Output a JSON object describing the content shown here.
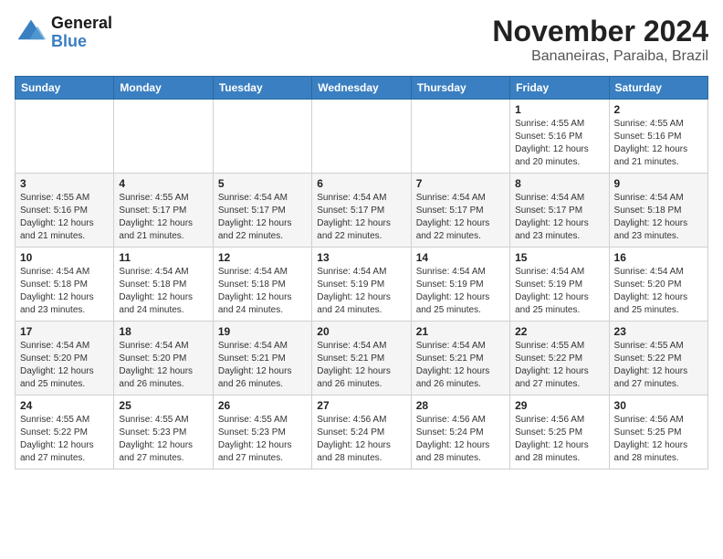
{
  "header": {
    "logo_line1": "General",
    "logo_line2": "Blue",
    "month": "November 2024",
    "location": "Bananeiras, Paraiba, Brazil"
  },
  "weekdays": [
    "Sunday",
    "Monday",
    "Tuesday",
    "Wednesday",
    "Thursday",
    "Friday",
    "Saturday"
  ],
  "weeks": [
    [
      {
        "day": "",
        "info": ""
      },
      {
        "day": "",
        "info": ""
      },
      {
        "day": "",
        "info": ""
      },
      {
        "day": "",
        "info": ""
      },
      {
        "day": "",
        "info": ""
      },
      {
        "day": "1",
        "info": "Sunrise: 4:55 AM\nSunset: 5:16 PM\nDaylight: 12 hours and 20 minutes."
      },
      {
        "day": "2",
        "info": "Sunrise: 4:55 AM\nSunset: 5:16 PM\nDaylight: 12 hours and 21 minutes."
      }
    ],
    [
      {
        "day": "3",
        "info": "Sunrise: 4:55 AM\nSunset: 5:16 PM\nDaylight: 12 hours and 21 minutes."
      },
      {
        "day": "4",
        "info": "Sunrise: 4:55 AM\nSunset: 5:17 PM\nDaylight: 12 hours and 21 minutes."
      },
      {
        "day": "5",
        "info": "Sunrise: 4:54 AM\nSunset: 5:17 PM\nDaylight: 12 hours and 22 minutes."
      },
      {
        "day": "6",
        "info": "Sunrise: 4:54 AM\nSunset: 5:17 PM\nDaylight: 12 hours and 22 minutes."
      },
      {
        "day": "7",
        "info": "Sunrise: 4:54 AM\nSunset: 5:17 PM\nDaylight: 12 hours and 22 minutes."
      },
      {
        "day": "8",
        "info": "Sunrise: 4:54 AM\nSunset: 5:17 PM\nDaylight: 12 hours and 23 minutes."
      },
      {
        "day": "9",
        "info": "Sunrise: 4:54 AM\nSunset: 5:18 PM\nDaylight: 12 hours and 23 minutes."
      }
    ],
    [
      {
        "day": "10",
        "info": "Sunrise: 4:54 AM\nSunset: 5:18 PM\nDaylight: 12 hours and 23 minutes."
      },
      {
        "day": "11",
        "info": "Sunrise: 4:54 AM\nSunset: 5:18 PM\nDaylight: 12 hours and 24 minutes."
      },
      {
        "day": "12",
        "info": "Sunrise: 4:54 AM\nSunset: 5:18 PM\nDaylight: 12 hours and 24 minutes."
      },
      {
        "day": "13",
        "info": "Sunrise: 4:54 AM\nSunset: 5:19 PM\nDaylight: 12 hours and 24 minutes."
      },
      {
        "day": "14",
        "info": "Sunrise: 4:54 AM\nSunset: 5:19 PM\nDaylight: 12 hours and 25 minutes."
      },
      {
        "day": "15",
        "info": "Sunrise: 4:54 AM\nSunset: 5:19 PM\nDaylight: 12 hours and 25 minutes."
      },
      {
        "day": "16",
        "info": "Sunrise: 4:54 AM\nSunset: 5:20 PM\nDaylight: 12 hours and 25 minutes."
      }
    ],
    [
      {
        "day": "17",
        "info": "Sunrise: 4:54 AM\nSunset: 5:20 PM\nDaylight: 12 hours and 25 minutes."
      },
      {
        "day": "18",
        "info": "Sunrise: 4:54 AM\nSunset: 5:20 PM\nDaylight: 12 hours and 26 minutes."
      },
      {
        "day": "19",
        "info": "Sunrise: 4:54 AM\nSunset: 5:21 PM\nDaylight: 12 hours and 26 minutes."
      },
      {
        "day": "20",
        "info": "Sunrise: 4:54 AM\nSunset: 5:21 PM\nDaylight: 12 hours and 26 minutes."
      },
      {
        "day": "21",
        "info": "Sunrise: 4:54 AM\nSunset: 5:21 PM\nDaylight: 12 hours and 26 minutes."
      },
      {
        "day": "22",
        "info": "Sunrise: 4:55 AM\nSunset: 5:22 PM\nDaylight: 12 hours and 27 minutes."
      },
      {
        "day": "23",
        "info": "Sunrise: 4:55 AM\nSunset: 5:22 PM\nDaylight: 12 hours and 27 minutes."
      }
    ],
    [
      {
        "day": "24",
        "info": "Sunrise: 4:55 AM\nSunset: 5:22 PM\nDaylight: 12 hours and 27 minutes."
      },
      {
        "day": "25",
        "info": "Sunrise: 4:55 AM\nSunset: 5:23 PM\nDaylight: 12 hours and 27 minutes."
      },
      {
        "day": "26",
        "info": "Sunrise: 4:55 AM\nSunset: 5:23 PM\nDaylight: 12 hours and 27 minutes."
      },
      {
        "day": "27",
        "info": "Sunrise: 4:56 AM\nSunset: 5:24 PM\nDaylight: 12 hours and 28 minutes."
      },
      {
        "day": "28",
        "info": "Sunrise: 4:56 AM\nSunset: 5:24 PM\nDaylight: 12 hours and 28 minutes."
      },
      {
        "day": "29",
        "info": "Sunrise: 4:56 AM\nSunset: 5:25 PM\nDaylight: 12 hours and 28 minutes."
      },
      {
        "day": "30",
        "info": "Sunrise: 4:56 AM\nSunset: 5:25 PM\nDaylight: 12 hours and 28 minutes."
      }
    ]
  ]
}
